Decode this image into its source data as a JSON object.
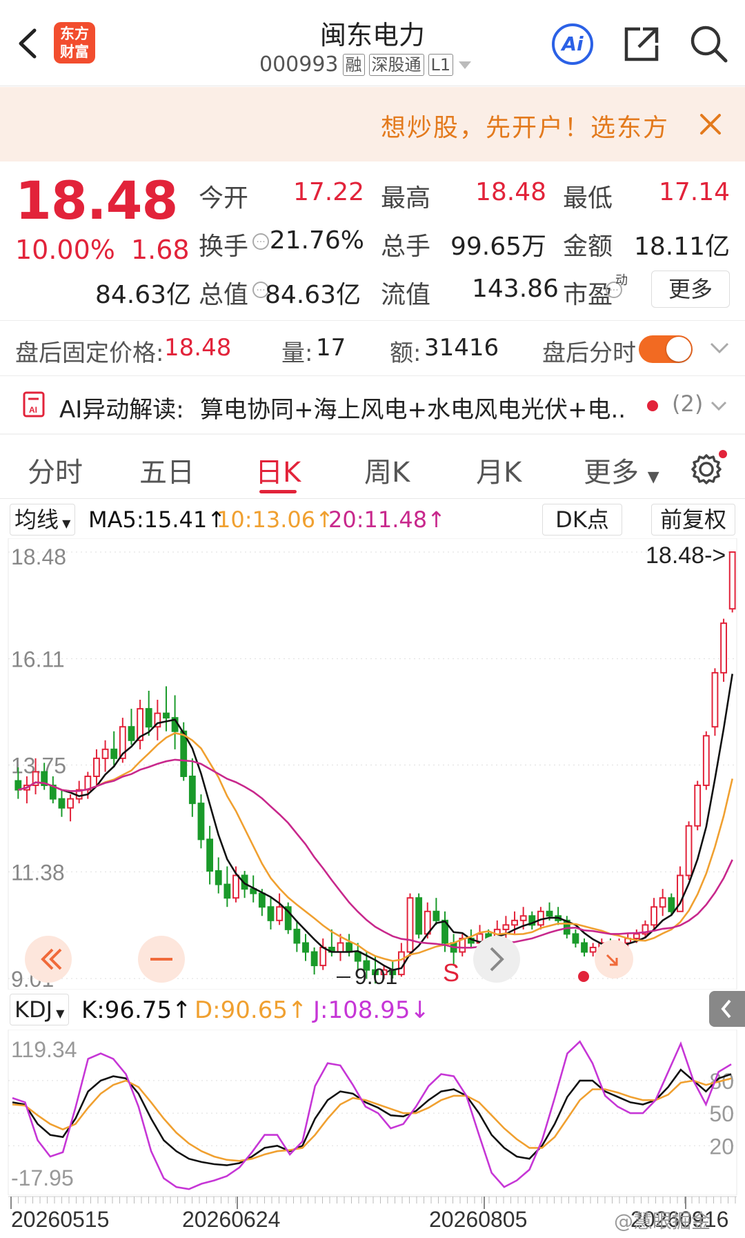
{
  "header": {
    "logo_text": "东方\n财富",
    "stock_name": "闽东电力",
    "code": "000993",
    "tags": [
      "融",
      "深股通",
      "L1"
    ],
    "ai_label": "Ai",
    "back_icon": "chevron-left-icon",
    "share_icon": "share-icon",
    "search_icon": "search-icon"
  },
  "promo": {
    "text": "想炒股，先开户！选东方",
    "close_icon": "close-icon"
  },
  "quote": {
    "price": "18.48",
    "change_pct": "10.00%",
    "change": "1.68",
    "stats": [
      {
        "label": "今开",
        "value": "17.22",
        "color": "#e2233a"
      },
      {
        "label": "最高",
        "value": "18.48",
        "color": "#e2233a"
      },
      {
        "label": "最低",
        "value": "17.14",
        "color": "#e2233a"
      },
      {
        "label": "换手",
        "value": "21.76%",
        "color": "#222222"
      },
      {
        "label": "总手",
        "value": "99.65万",
        "color": "#222222"
      },
      {
        "label": "金额",
        "value": "18.11亿",
        "color": "#222222"
      },
      {
        "label": "总值",
        "value": "84.63亿",
        "color": "#222222"
      },
      {
        "label": "流值",
        "value": "84.63亿",
        "color": "#222222"
      },
      {
        "label": "市盈",
        "value": "143.86",
        "color": "#222222"
      }
    ],
    "pe_superscript": "动",
    "more_label": "更多"
  },
  "after_hours": {
    "price_label": "盘后固定价格:",
    "price_value": "18.48",
    "volume_label": "量:",
    "volume_value": "17",
    "amount_label": "额:",
    "amount_value": "31416",
    "toggle_label": "盘后分时",
    "toggle_on": true
  },
  "ai_insight": {
    "label": "AI异动解读:",
    "text": "算电协同+海上风电+水电风电光伏+电...",
    "count": "(2)"
  },
  "tabs": [
    "分时",
    "五日",
    "日K",
    "周K",
    "月K",
    "更多"
  ],
  "active_tab": "日K",
  "ma_bar": {
    "selector": "均线",
    "ma5": "MA5:15.41",
    "ma10": "10:13.06",
    "ma20": "20:11.48",
    "dk_button": "DK点",
    "adjust_button": "前复权"
  },
  "kdj_bar": {
    "selector": "KDJ",
    "k": "K:96.75",
    "d": "D:90.65",
    "j": "J:108.95"
  },
  "chart_overlays": {
    "last_price_tag": "18.48->",
    "low_tag": "9.01",
    "signal_s": "S"
  },
  "watermark": "@慧眼掘金",
  "colors": {
    "up": "#e2233a",
    "down": "#1a9a2a",
    "ma5": "#111111",
    "ma10": "#f0a030",
    "ma20": "#c8288c",
    "j": "#c636d6",
    "accent_promo": "#e37a1d"
  },
  "chart_data": [
    {
      "type": "candlestick",
      "title": "",
      "y_ticks": [
        "18.48",
        "16.11",
        "13.75",
        "11.38",
        "9.01"
      ],
      "ylim": [
        9.01,
        18.48
      ],
      "x_ticks": [
        "20260515",
        "20260624",
        "20260805",
        "20260916"
      ],
      "ohlc": [
        [
          13.4,
          13.7,
          13.0,
          13.2
        ],
        [
          13.2,
          13.5,
          12.9,
          13.3
        ],
        [
          13.3,
          13.9,
          13.1,
          13.6
        ],
        [
          13.6,
          13.8,
          13.2,
          13.3
        ],
        [
          13.3,
          13.5,
          12.9,
          13.0
        ],
        [
          13.0,
          13.2,
          12.6,
          12.8
        ],
        [
          12.8,
          13.1,
          12.5,
          13.0
        ],
        [
          13.0,
          13.4,
          12.9,
          13.2
        ],
        [
          13.2,
          13.6,
          13.0,
          13.5
        ],
        [
          13.5,
          14.1,
          13.3,
          13.9
        ],
        [
          13.9,
          14.3,
          13.6,
          14.1
        ],
        [
          14.1,
          14.5,
          13.7,
          13.9
        ],
        [
          13.9,
          14.8,
          13.8,
          14.6
        ],
        [
          14.6,
          15.0,
          14.2,
          14.3
        ],
        [
          14.3,
          15.2,
          14.1,
          15.0
        ],
        [
          15.0,
          15.4,
          14.4,
          14.6
        ],
        [
          14.6,
          15.2,
          14.3,
          14.9
        ],
        [
          14.9,
          15.5,
          14.5,
          14.8
        ],
        [
          14.8,
          15.3,
          14.1,
          14.5
        ],
        [
          14.5,
          14.7,
          13.4,
          13.5
        ],
        [
          13.5,
          13.9,
          12.6,
          12.9
        ],
        [
          12.9,
          13.1,
          11.9,
          12.1
        ],
        [
          12.1,
          12.4,
          11.1,
          11.4
        ],
        [
          11.4,
          11.7,
          10.9,
          11.1
        ],
        [
          11.1,
          11.5,
          10.6,
          10.8
        ],
        [
          10.8,
          11.5,
          10.7,
          11.3
        ],
        [
          11.3,
          11.4,
          10.8,
          11.0
        ],
        [
          11.0,
          11.3,
          10.7,
          10.9
        ],
        [
          10.9,
          11.0,
          10.4,
          10.6
        ],
        [
          10.6,
          10.8,
          10.1,
          10.3
        ],
        [
          10.3,
          10.9,
          10.2,
          10.6
        ],
        [
          10.6,
          10.7,
          10.0,
          10.1
        ],
        [
          10.1,
          10.3,
          9.6,
          9.8
        ],
        [
          9.8,
          10.0,
          9.4,
          9.6
        ],
        [
          9.6,
          9.7,
          9.1,
          9.3
        ],
        [
          9.3,
          9.9,
          9.2,
          9.7
        ],
        [
          9.7,
          10.1,
          9.5,
          9.6
        ],
        [
          9.6,
          10.0,
          9.4,
          9.8
        ],
        [
          9.8,
          10.0,
          9.5,
          9.6
        ],
        [
          9.6,
          9.8,
          9.2,
          9.4
        ],
        [
          9.4,
          9.6,
          9.0,
          9.2
        ],
        [
          9.2,
          9.5,
          8.9,
          9.1
        ],
        [
          9.1,
          9.3,
          9.0,
          9.2
        ],
        [
          9.2,
          9.4,
          9.01,
          9.1
        ],
        [
          9.1,
          9.8,
          9.05,
          9.6
        ],
        [
          9.6,
          10.9,
          9.5,
          10.8
        ],
        [
          10.8,
          10.9,
          9.9,
          10.0
        ],
        [
          10.0,
          10.7,
          9.9,
          10.5
        ],
        [
          10.5,
          10.8,
          10.2,
          10.3
        ],
        [
          10.3,
          10.5,
          9.6,
          9.8
        ],
        [
          9.8,
          10.0,
          9.3,
          9.6
        ],
        [
          9.6,
          10.0,
          9.5,
          9.9
        ],
        [
          9.9,
          10.1,
          9.7,
          9.8
        ],
        [
          9.8,
          10.2,
          9.7,
          10.0
        ],
        [
          10.0,
          10.1,
          9.8,
          9.9
        ],
        [
          9.9,
          10.3,
          9.8,
          10.1
        ],
        [
          10.1,
          10.4,
          9.9,
          10.2
        ],
        [
          10.2,
          10.5,
          10.0,
          10.3
        ],
        [
          10.3,
          10.6,
          10.1,
          10.4
        ],
        [
          10.4,
          10.5,
          10.1,
          10.2
        ],
        [
          10.2,
          10.6,
          10.1,
          10.5
        ],
        [
          10.5,
          10.7,
          10.3,
          10.4
        ],
        [
          10.4,
          10.6,
          10.2,
          10.3
        ],
        [
          10.3,
          10.4,
          9.9,
          10.0
        ],
        [
          10.0,
          10.1,
          9.7,
          9.8
        ],
        [
          9.8,
          9.9,
          9.5,
          9.6
        ],
        [
          9.6,
          9.8,
          9.5,
          9.7
        ],
        [
          9.7,
          9.9,
          9.6,
          9.8
        ],
        [
          9.8,
          9.9,
          9.6,
          9.7
        ],
        [
          9.7,
          9.9,
          9.6,
          9.8
        ],
        [
          9.8,
          10.0,
          9.7,
          9.9
        ],
        [
          9.9,
          10.1,
          9.8,
          10.0
        ],
        [
          10.0,
          10.3,
          9.9,
          10.2
        ],
        [
          10.2,
          10.8,
          10.1,
          10.6
        ],
        [
          10.6,
          11.0,
          10.4,
          10.8
        ],
        [
          10.8,
          10.9,
          10.4,
          10.5
        ],
        [
          10.5,
          11.5,
          10.5,
          11.3
        ],
        [
          11.3,
          12.5,
          11.2,
          12.4
        ],
        [
          12.4,
          13.4,
          12.3,
          13.3
        ],
        [
          13.3,
          14.5,
          13.2,
          14.4
        ],
        [
          14.6,
          15.9,
          14.4,
          15.8
        ],
        [
          15.8,
          17.0,
          15.6,
          16.9
        ],
        [
          17.22,
          18.48,
          17.14,
          18.48
        ]
      ],
      "ma5_last": 15.41,
      "ma10_last": 13.06,
      "ma20_last": 11.48
    },
    {
      "type": "line",
      "title": "KDJ",
      "y_ticks": [
        "119.34",
        "80",
        "50",
        "20",
        "-17.95"
      ],
      "ylim": [
        -17.95,
        119.34
      ],
      "series": [
        {
          "name": "K",
          "values": [
            60,
            58,
            40,
            30,
            28,
            45,
            70,
            80,
            84,
            82,
            68,
            45,
            25,
            15,
            8,
            5,
            3,
            2,
            4,
            10,
            18,
            20,
            15,
            20,
            45,
            62,
            70,
            68,
            60,
            55,
            48,
            47,
            52,
            62,
            70,
            72,
            66,
            50,
            30,
            18,
            10,
            8,
            20,
            40,
            65,
            80,
            80,
            70,
            65,
            60,
            58,
            62,
            74,
            90,
            80,
            70,
            82,
            86
          ]
        },
        {
          "name": "D",
          "values": [
            58,
            57,
            48,
            40,
            35,
            40,
            55,
            68,
            76,
            80,
            74,
            60,
            45,
            32,
            22,
            15,
            10,
            7,
            6,
            8,
            12,
            15,
            16,
            18,
            30,
            45,
            58,
            64,
            62,
            58,
            54,
            50,
            50,
            55,
            62,
            66,
            66,
            60,
            48,
            36,
            26,
            18,
            18,
            28,
            45,
            62,
            72,
            72,
            69,
            65,
            62,
            62,
            67,
            78,
            80,
            76,
            79,
            82
          ]
        },
        {
          "name": "J",
          "values": [
            64,
            60,
            25,
            10,
            14,
            55,
            100,
            105,
            100,
            86,
            56,
            15,
            -10,
            -18,
            -20,
            -15,
            -12,
            -8,
            0,
            14,
            30,
            30,
            12,
            24,
            75,
            96,
            94,
            76,
            56,
            50,
            36,
            40,
            56,
            75,
            86,
            84,
            66,
            30,
            -5,
            -18,
            -12,
            -2,
            25,
            64,
            105,
            116,
            96,
            66,
            56,
            50,
            50,
            62,
            88,
            114,
            80,
            58,
            88,
            95
          ]
        }
      ]
    }
  ]
}
